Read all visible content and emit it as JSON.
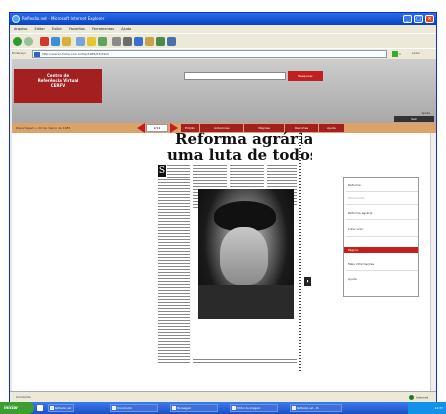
{
  "window": {
    "title": "Reflexão.net - Microsoft Internet Explorer",
    "menu": [
      "Arquivo",
      "Editar",
      "Exibir",
      "Favoritos",
      "Ferramentas",
      "Ajuda"
    ],
    "address_label": "Endereço",
    "address": "http://acervo.folha.com.br/fsp/1985/03/24/2/",
    "go_label": "Ir",
    "links_label": "Links"
  },
  "site": {
    "logo_lines": [
      "Centro de",
      "Referência Virtual",
      "CERFV"
    ],
    "search_button": "Pesquisar",
    "help_link": "Ajuda",
    "exit_button": "Sair"
  },
  "nav": {
    "breadcrumb": "Reportagem » 24 de março de 1985",
    "page": "2/12",
    "tabs": [
      "Edição",
      "Anteriores",
      "Páginas",
      "Recortes",
      "Ajuda"
    ]
  },
  "article": {
    "headline_line1": "Reforma agrária,",
    "headline_line2": "uma luta de todos",
    "dropcap": "S"
  },
  "menu": {
    "items": [
      "Reforma",
      "Movimento",
      "Reforma agrária",
      "Luta rural",
      "Página",
      "Mais informações",
      "Ajuda"
    ],
    "selected_index": 4
  },
  "status": {
    "text": "Concluído",
    "zone": "Internet"
  },
  "taskbar": {
    "start": "iniciar",
    "tasks": [
      "Reflexão.net",
      "Documento",
      "Mensagem",
      "Editor de Imagem",
      "Reflexão.net - M..."
    ],
    "clock": "14:37"
  }
}
